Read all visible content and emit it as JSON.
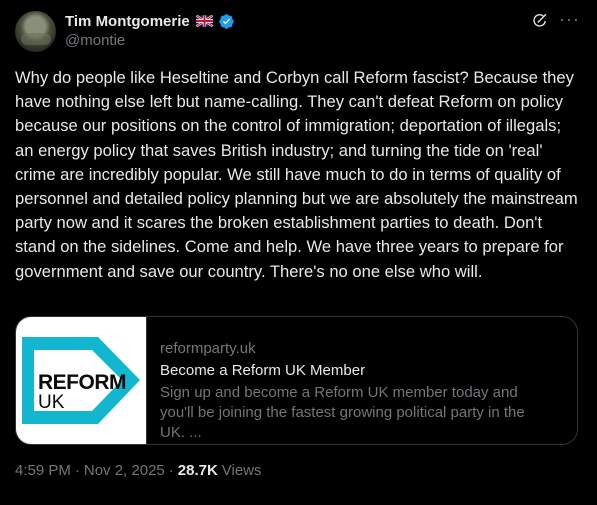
{
  "author": {
    "display_name": "Tim Montgomerie",
    "handle": "@montie",
    "flag_icon": "uk-flag-icon",
    "verified_icon": "verified-badge-icon"
  },
  "tweet": {
    "text": "Why do people like Heseltine and Corbyn call Reform fascist? Because they have nothing else left but name-calling. They can't defeat Reform on policy because our positions on the control of immigration; deportation of illegals; an energy policy that saves British industry; and turning the tide on 'real' crime are incredibly popular. We still have much to do in terms of quality of personnel and detailed policy planning but we are absolutely the mainstream party now and it scares the broken establishment parties to death. Don't stand on the sidelines. Come and help. We have three years to prepare for government and save our country. There's no one else who will."
  },
  "card": {
    "domain": "reformparty.uk",
    "title": "Become a Reform UK Member",
    "description": "Sign up and become a Reform UK member today and you'll be joining the fastest growing political party in the UK. ...",
    "logo_line1": "REFORM",
    "logo_line2": "UK",
    "logo_color": "#12B6CF"
  },
  "meta": {
    "time": "4:59 PM",
    "separator1": "·",
    "date": "Nov 2, 2025",
    "separator2": "·",
    "views_count": "28.7K",
    "views_label": "Views"
  },
  "colors": {
    "background": "#000000",
    "text": "#e7e9ea",
    "muted": "#71767b",
    "verified": "#1d9bf0",
    "border": "#2f3336"
  }
}
